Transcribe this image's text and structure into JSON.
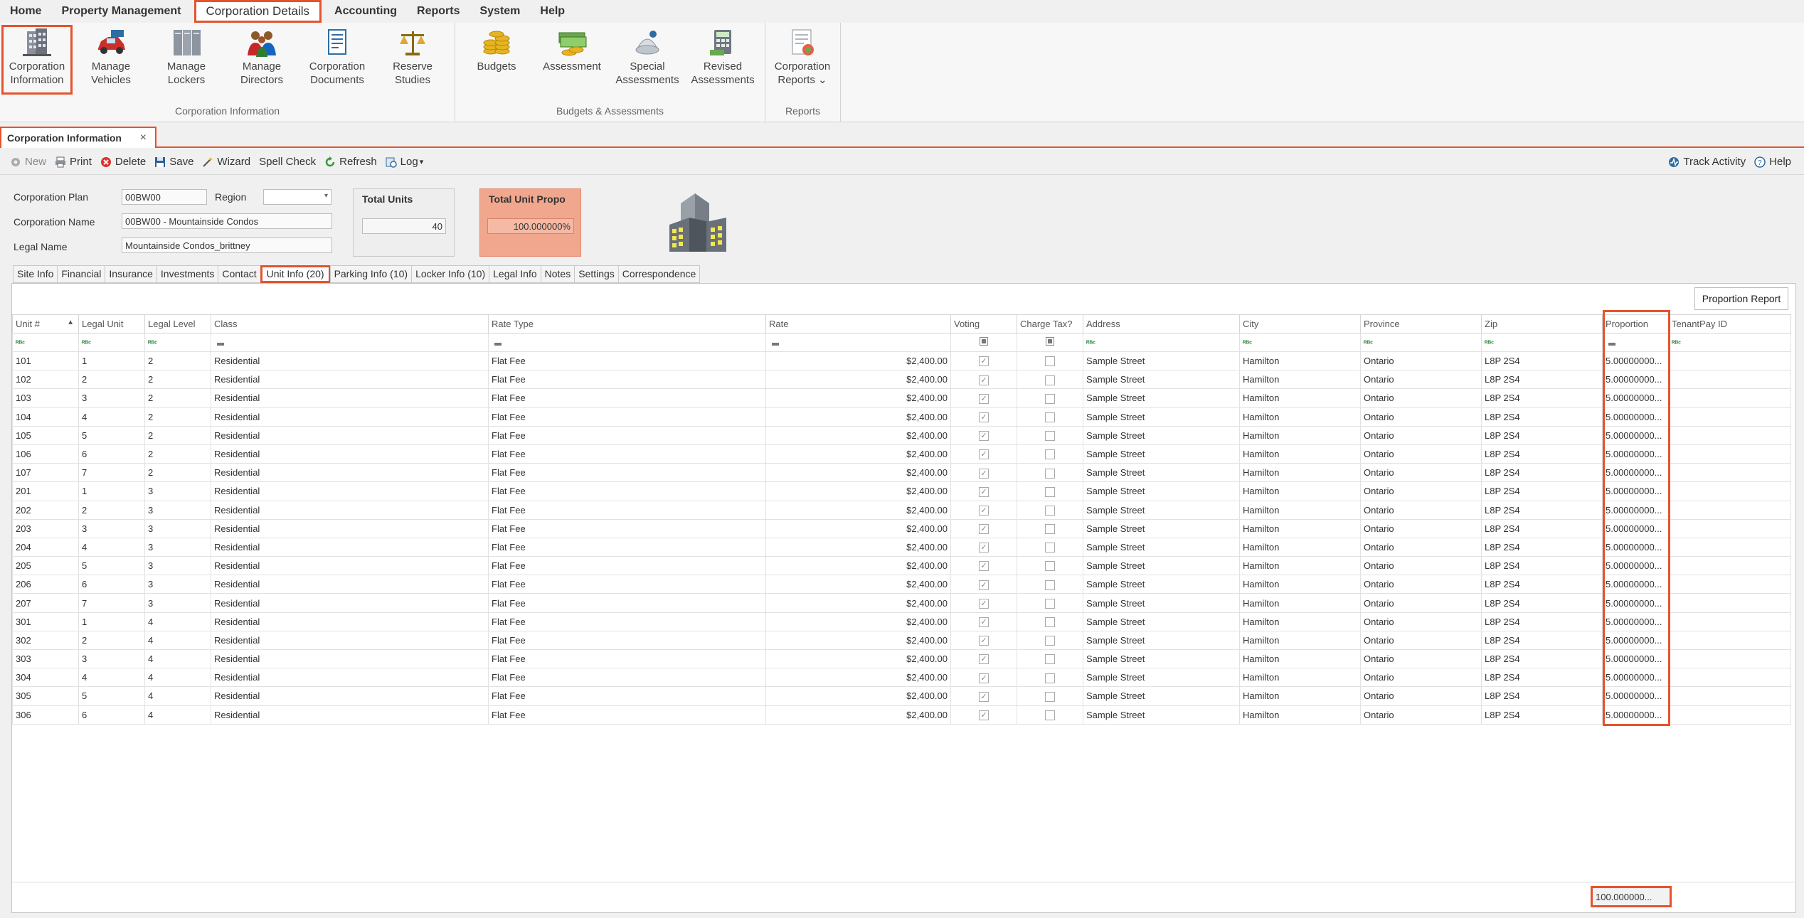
{
  "menu": [
    "Home",
    "Property Management",
    "Corporation Details",
    "Accounting",
    "Reports",
    "System",
    "Help"
  ],
  "ribbon": {
    "groups": [
      {
        "label": "Corporation Information",
        "buttons": [
          {
            "line1": "Corporation",
            "line2": "Information",
            "icon": "building-icon"
          },
          {
            "line1": "Manage",
            "line2": "Vehicles",
            "icon": "car-icon"
          },
          {
            "line1": "Manage",
            "line2": "Lockers",
            "icon": "locker-icon"
          },
          {
            "line1": "Manage",
            "line2": "Directors",
            "icon": "directors-icon"
          },
          {
            "line1": "Corporation",
            "line2": "Documents",
            "icon": "documents-icon"
          },
          {
            "line1": "Reserve",
            "line2": "Studies",
            "icon": "scales-icon"
          }
        ]
      },
      {
        "label": "Budgets & Assessments",
        "buttons": [
          {
            "line1": "Budgets",
            "line2": "",
            "icon": "coins-icon"
          },
          {
            "line1": "Assessment",
            "line2": "",
            "icon": "money-icon"
          },
          {
            "line1": "Special",
            "line2": "Assessments",
            "icon": "special-icon"
          },
          {
            "line1": "Revised",
            "line2": "Assessments",
            "icon": "calculator-icon"
          }
        ]
      },
      {
        "label": "Reports",
        "buttons": [
          {
            "line1": "Corporation",
            "line2": "Reports ⌄",
            "icon": "report-icon"
          }
        ]
      }
    ]
  },
  "doc_tab": {
    "title": "Corporation Information",
    "close": "×"
  },
  "toolbar": {
    "left": [
      "New",
      "Print",
      "Delete",
      "Save",
      "Wizard",
      "Spell Check",
      "Refresh",
      "Log"
    ],
    "log_arrow": "▾",
    "right": [
      "Track Activity",
      "Help"
    ]
  },
  "form": {
    "plan_label": "Corporation Plan",
    "plan_value": "00BW00",
    "region_label": "Region",
    "region_value": "",
    "name_label": "Corporation Name",
    "name_value": "00BW00 - Mountainside Condos",
    "legal_label": "Legal Name",
    "legal_value": "Mountainside Condos_brittney",
    "total_units_title": "Total Units",
    "total_units_value": "40",
    "total_prop_title": "Total Unit Propo",
    "total_prop_value": "100.000000%"
  },
  "subtabs": [
    "Site Info",
    "Financial",
    "Insurance",
    "Investments",
    "Contact",
    "Unit Info (20)",
    "Parking Info (10)",
    "Locker Info (10)",
    "Legal Info",
    "Notes",
    "Settings",
    "Correspondence"
  ],
  "proportion_report": "Proportion Report",
  "columns": [
    "Unit #",
    "Legal Unit",
    "Legal Level",
    "Class",
    "Rate Type",
    "Rate",
    "Voting",
    "Charge Tax?",
    "Address",
    "City",
    "Province",
    "Zip",
    "Proportion",
    "TenantPay ID"
  ],
  "sort_arrow": "▲",
  "filter_abc": "ᴿᴮᶜ",
  "rows": [
    [
      "101",
      "1",
      "2",
      "Residential",
      "Flat Fee",
      "$2,400.00",
      true,
      false,
      "Sample Street",
      "Hamilton",
      "Ontario",
      "L8P 2S4",
      "5.00000000...",
      ""
    ],
    [
      "102",
      "2",
      "2",
      "Residential",
      "Flat Fee",
      "$2,400.00",
      true,
      false,
      " Sample Street",
      "Hamilton",
      "Ontario",
      "L8P 2S4",
      "5.00000000...",
      ""
    ],
    [
      "103",
      "3",
      "2",
      "Residential",
      "Flat Fee",
      "$2,400.00",
      true,
      false,
      "Sample Street",
      "Hamilton",
      "Ontario",
      "L8P 2S4",
      "5.00000000...",
      ""
    ],
    [
      "104",
      "4",
      "2",
      "Residential",
      "Flat Fee",
      "$2,400.00",
      true,
      false,
      "Sample Street",
      "Hamilton",
      "Ontario",
      "L8P 2S4",
      "5.00000000...",
      ""
    ],
    [
      "105",
      "5",
      "2",
      "Residential",
      "Flat Fee",
      "$2,400.00",
      true,
      false,
      "Sample Street",
      "Hamilton",
      "Ontario",
      "L8P 2S4",
      "5.00000000...",
      ""
    ],
    [
      "106",
      "6",
      "2",
      "Residential",
      "Flat Fee",
      "$2,400.00",
      true,
      false,
      "Sample Street",
      "Hamilton",
      "Ontario",
      "L8P 2S4",
      "5.00000000...",
      ""
    ],
    [
      "107",
      "7",
      "2",
      "Residential",
      "Flat Fee",
      "$2,400.00",
      true,
      false,
      "Sample Street",
      "Hamilton",
      "Ontario",
      "L8P 2S4",
      "5.00000000...",
      ""
    ],
    [
      "201",
      "1",
      "3",
      "Residential",
      "Flat Fee",
      "$2,400.00",
      true,
      false,
      "Sample Street",
      "Hamilton",
      "Ontario",
      "L8P 2S4",
      "5.00000000...",
      ""
    ],
    [
      "202",
      "2",
      "3",
      "Residential",
      "Flat Fee",
      "$2,400.00",
      true,
      false,
      "Sample Street",
      "Hamilton",
      "Ontario",
      "L8P 2S4",
      "5.00000000...",
      ""
    ],
    [
      "203",
      "3",
      "3",
      "Residential",
      "Flat Fee",
      "$2,400.00",
      true,
      false,
      "Sample Street",
      "Hamilton",
      "Ontario",
      "L8P 2S4",
      "5.00000000...",
      ""
    ],
    [
      "204",
      "4",
      "3",
      "Residential",
      "Flat Fee",
      "$2,400.00",
      true,
      false,
      "Sample Street",
      "Hamilton",
      "Ontario",
      "L8P 2S4",
      "5.00000000...",
      ""
    ],
    [
      "205",
      "5",
      "3",
      "Residential",
      "Flat Fee",
      "$2,400.00",
      true,
      false,
      "Sample Street",
      "Hamilton",
      "Ontario",
      "L8P 2S4",
      "5.00000000...",
      ""
    ],
    [
      "206",
      "6",
      "3",
      "Residential",
      "Flat Fee",
      "$2,400.00",
      true,
      false,
      "Sample Street",
      "Hamilton",
      "Ontario",
      "L8P 2S4",
      "5.00000000...",
      ""
    ],
    [
      "207",
      "7",
      "3",
      "Residential",
      "Flat Fee",
      "$2,400.00",
      true,
      false,
      "Sample Street",
      "Hamilton",
      "Ontario",
      "L8P 2S4",
      "5.00000000...",
      ""
    ],
    [
      "301",
      "1",
      "4",
      "Residential",
      "Flat Fee",
      "$2,400.00",
      true,
      false,
      "Sample Street",
      "Hamilton",
      "Ontario",
      "L8P 2S4",
      "5.00000000...",
      ""
    ],
    [
      "302",
      "2",
      "4",
      "Residential",
      "Flat Fee",
      "$2,400.00",
      true,
      false,
      "Sample Street",
      "Hamilton",
      "Ontario",
      "L8P 2S4",
      "5.00000000...",
      ""
    ],
    [
      "303",
      "3",
      "4",
      "Residential",
      "Flat Fee",
      "$2,400.00",
      true,
      false,
      "Sample Street",
      "Hamilton",
      "Ontario",
      "L8P 2S4",
      "5.00000000...",
      ""
    ],
    [
      "304",
      "4",
      "4",
      "Residential",
      "Flat Fee",
      "$2,400.00",
      true,
      false,
      "Sample Street",
      "Hamilton",
      "Ontario",
      "L8P 2S4",
      "5.00000000...",
      ""
    ],
    [
      "305",
      "5",
      "4",
      "Residential",
      "Flat Fee",
      "$2,400.00",
      true,
      false,
      "Sample Street",
      "Hamilton",
      "Ontario",
      "L8P 2S4",
      "5.00000000...",
      ""
    ],
    [
      "306",
      "6",
      "4",
      "Residential",
      "Flat Fee",
      "$2,400.00",
      true,
      false,
      "Sample Street",
      "Hamilton",
      "Ontario",
      "L8P 2S4",
      "5.00000000...",
      ""
    ]
  ],
  "footer_total": "100.000000...",
  "colors": {
    "highlight": "#e5532d",
    "total_prop_bg": "#f0a78e",
    "filter_green": "#2c8a3a"
  }
}
